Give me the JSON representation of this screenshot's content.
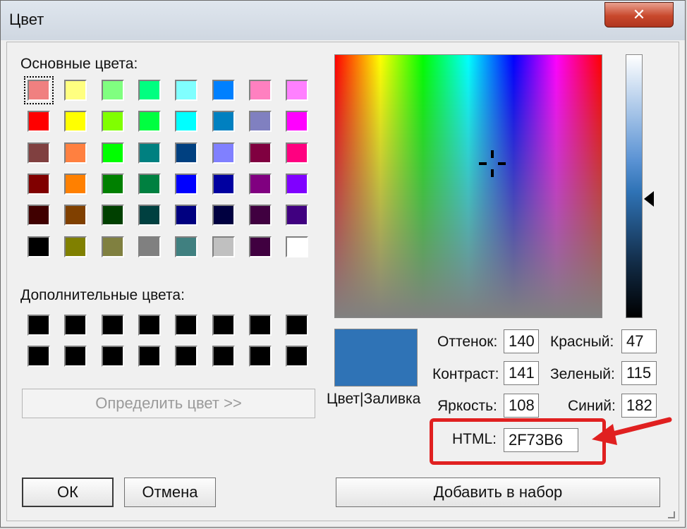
{
  "window": {
    "title": "Цвет",
    "close_label": "✕"
  },
  "basic_colors": {
    "label": "Основные цвета:",
    "swatches": [
      "#f08080",
      "#ffff80",
      "#80ff80",
      "#00ff80",
      "#80ffff",
      "#0080ff",
      "#ff80c0",
      "#ff80ff",
      "#ff0000",
      "#ffff00",
      "#80ff00",
      "#00ff40",
      "#00ffff",
      "#0080c0",
      "#8080c0",
      "#ff00ff",
      "#804040",
      "#ff8040",
      "#00ff00",
      "#008080",
      "#004080",
      "#8080ff",
      "#800040",
      "#ff0080",
      "#800000",
      "#ff8000",
      "#008000",
      "#008040",
      "#0000ff",
      "#0000a0",
      "#800080",
      "#8000ff",
      "#400000",
      "#804000",
      "#004000",
      "#004040",
      "#000080",
      "#000040",
      "#400040",
      "#400080",
      "#000000",
      "#808000",
      "#808040",
      "#808080",
      "#408080",
      "#c0c0c0",
      "#400040",
      "#ffffff"
    ]
  },
  "custom_colors": {
    "label": "Дополнительные цвета:",
    "swatches": [
      "#000000",
      "#000000",
      "#000000",
      "#000000",
      "#000000",
      "#000000",
      "#000000",
      "#000000",
      "#000000",
      "#000000",
      "#000000",
      "#000000",
      "#000000",
      "#000000",
      "#000000",
      "#000000"
    ]
  },
  "define_button": "Определить цвет >>",
  "preview": {
    "color": "#2f73b6",
    "label": "Цвет|Заливка"
  },
  "fields": {
    "hue": {
      "label": "Оттенок:",
      "value": "140"
    },
    "sat": {
      "label": "Контраст:",
      "value": "141"
    },
    "lum": {
      "label": "Яркость:",
      "value": "108"
    },
    "red": {
      "label": "Красный:",
      "value": "47"
    },
    "green": {
      "label": "Зеленый:",
      "value": "115"
    },
    "blue": {
      "label": "Синий:",
      "value": "182"
    },
    "html": {
      "label": "HTML:",
      "value": "2F73B6"
    }
  },
  "buttons": {
    "ok": "ОК",
    "cancel": "Отмена",
    "add": "Добавить в набор"
  },
  "colors": {
    "annotation": "#e02020"
  }
}
